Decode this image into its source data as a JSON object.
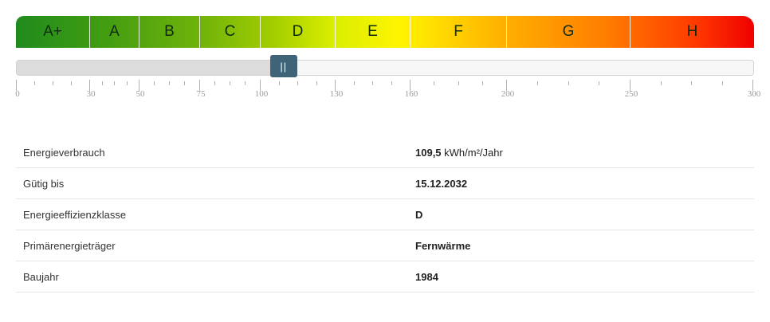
{
  "energy_classes": [
    "A+",
    "A",
    "B",
    "C",
    "D",
    "E",
    "F",
    "G",
    "H"
  ],
  "slider": {
    "min": 0,
    "max": 300,
    "value": 109.5,
    "handle_glyph": "||"
  },
  "scale": {
    "labels": [
      "0",
      "30",
      "50",
      "75",
      "100",
      "130",
      "160",
      "200",
      "250",
      "300"
    ],
    "label_values": [
      0,
      30,
      50,
      75,
      100,
      130,
      160,
      200,
      250,
      300
    ]
  },
  "rows": [
    {
      "label": "Energieverbrauch",
      "value": "109,5",
      "unit": " kWh/m²/Jahr"
    },
    {
      "label": "Gütig bis",
      "value": "15.12.2032"
    },
    {
      "label": "Energieeffizienzklasse",
      "value": "D"
    },
    {
      "label": "Primärenergieträger",
      "value": "Fernwärme"
    },
    {
      "label": "Baujahr",
      "value": "1984"
    }
  ]
}
